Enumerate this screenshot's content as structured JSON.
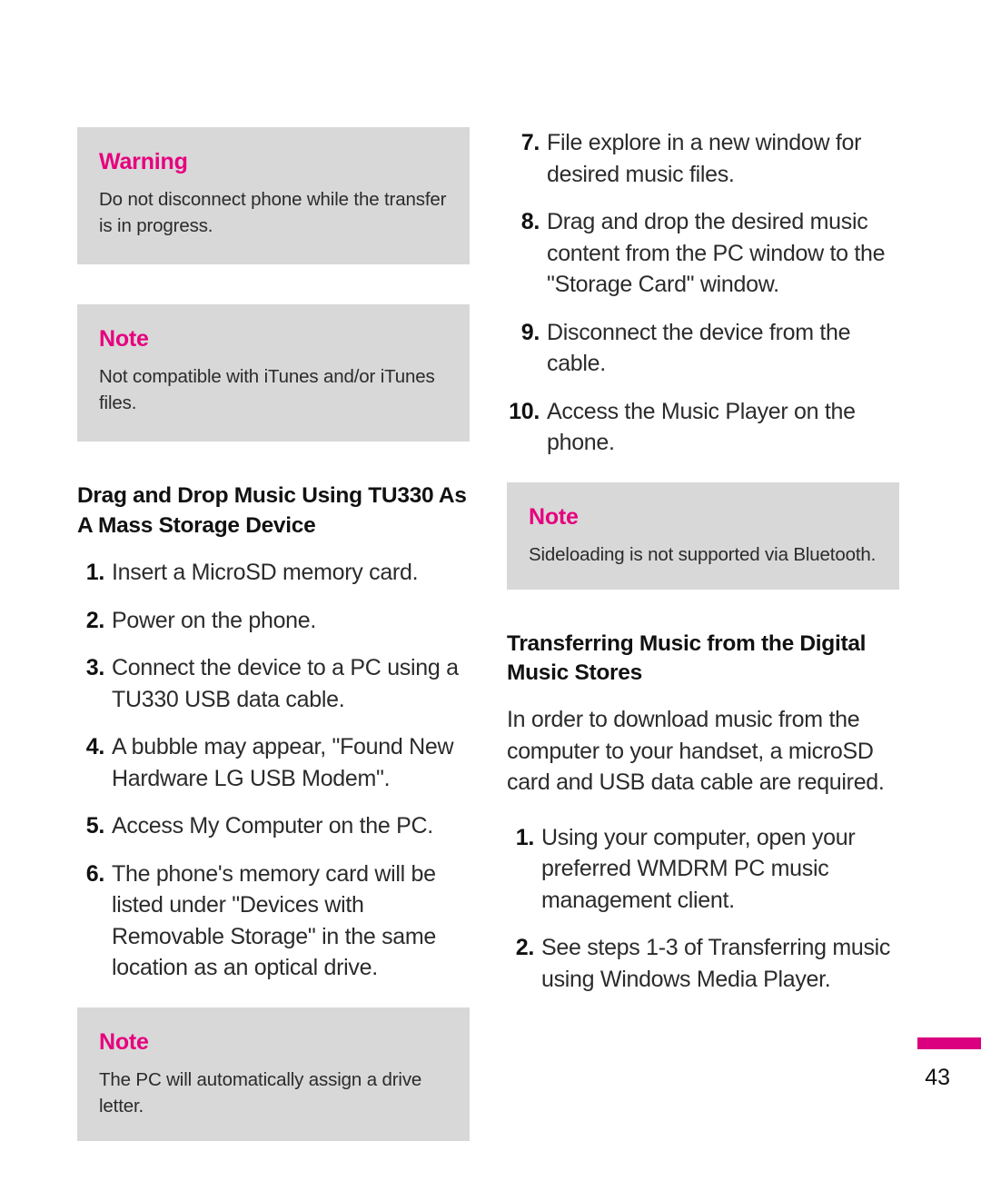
{
  "page": {
    "number": "43",
    "accent_color": "#e6007e",
    "tab_marker_color": "#da0080",
    "callout_bg": "#d8d8d8"
  },
  "left_column": {
    "warning_callout": {
      "title": "Warning",
      "body": "Do not disconnect phone while the transfer is in progress."
    },
    "note_callout_itunes": {
      "title": "Note",
      "body": "Not compatible with iTunes and/or iTunes files."
    },
    "heading": "Drag and Drop Music Using TU330 As A Mass Storage Device",
    "steps": [
      {
        "num": "1.",
        "text": "Insert a MicroSD memory card."
      },
      {
        "num": "2.",
        "text": "Power on the phone."
      },
      {
        "num": "3.",
        "text": "Connect the device to a PC using a TU330 USB data cable."
      },
      {
        "num": "4.",
        "text": "A bubble may appear, \"Found New Hardware LG USB Modem\"."
      },
      {
        "num": "5.",
        "text": "Access My Computer on the PC."
      },
      {
        "num": "6.",
        "text": "The phone's memory card will be listed under \"Devices with Removable Storage\" in the same location as an optical drive."
      }
    ],
    "note_callout_drive": {
      "title": "Note",
      "body": "The PC will automatically assign a drive letter."
    }
  },
  "right_column": {
    "steps_continued": [
      {
        "num": "7.",
        "text": "File explore in a new window for desired music files."
      },
      {
        "num": "8.",
        "text": "Drag and drop the desired music content from the PC window to the \"Storage Card\" window."
      },
      {
        "num": "9.",
        "text": "Disconnect the device from the cable."
      },
      {
        "num": "10.",
        "text": "Access the Music Player on the phone."
      }
    ],
    "note_callout_bluetooth": {
      "title": "Note",
      "body": "Sideloading is not supported via Bluetooth."
    },
    "heading": "Transferring Music from the Digital Music Stores",
    "paragraph": "In order to download music from the computer to your handset, a microSD card and USB data cable are required.",
    "steps": [
      {
        "num": "1.",
        "text": "Using your computer, open your preferred WMDRM PC music management client."
      },
      {
        "num": "2.",
        "text": "See steps 1-3 of Transferring music using Windows Media Player."
      }
    ]
  }
}
